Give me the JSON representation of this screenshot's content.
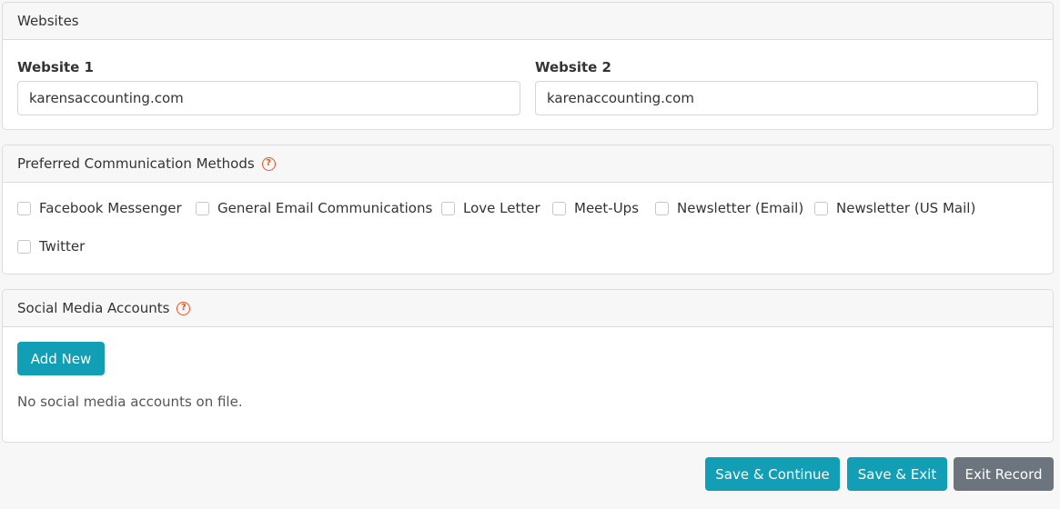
{
  "websites": {
    "header": "Websites",
    "website1_label": "Website 1",
    "website1_value": "karensaccounting.com",
    "website2_label": "Website 2",
    "website2_value": "karenaccounting.com"
  },
  "communication": {
    "header": "Preferred Communication Methods",
    "help_icon": "question-circle-icon",
    "options": [
      {
        "label": "Facebook Messenger",
        "checked": false
      },
      {
        "label": "General Email Communications",
        "checked": false
      },
      {
        "label": "Love Letter",
        "checked": false
      },
      {
        "label": "Meet-Ups",
        "checked": false
      },
      {
        "label": "Newsletter (Email)",
        "checked": false
      },
      {
        "label": "Newsletter (US Mail)",
        "checked": false
      },
      {
        "label": "Twitter",
        "checked": false
      }
    ]
  },
  "social": {
    "header": "Social Media Accounts",
    "help_icon": "question-circle-icon",
    "add_new_label": "Add New",
    "empty_text": "No social media accounts on file."
  },
  "footer": {
    "save_continue_label": "Save & Continue",
    "save_exit_label": "Save & Exit",
    "exit_record_label": "Exit Record"
  },
  "colors": {
    "accent": "#129fb5",
    "secondary": "#6c757d",
    "help": "#e8541e"
  }
}
